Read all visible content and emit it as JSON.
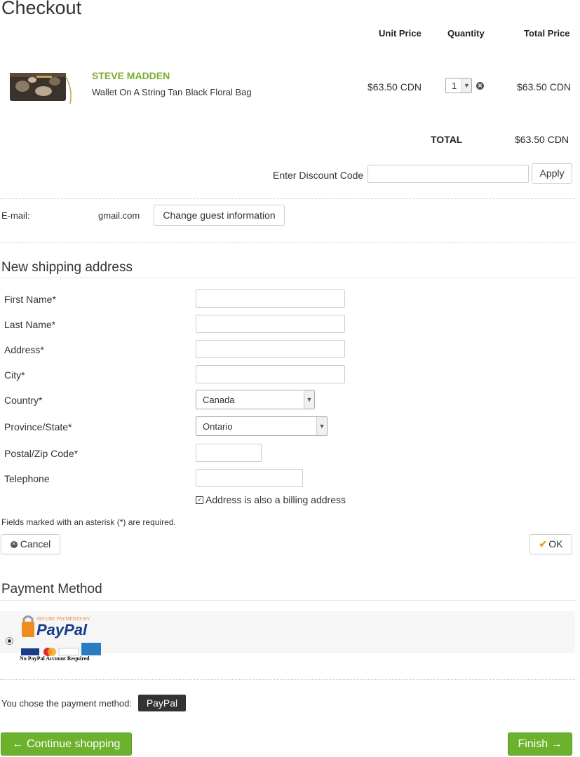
{
  "page": {
    "title": "Checkout"
  },
  "cart": {
    "headers": {
      "unit_price": "Unit Price",
      "quantity": "Quantity",
      "total_price": "Total Price"
    },
    "items": [
      {
        "brand": "STEVE MADDEN",
        "name": "Wallet On A String Tan Black Floral Bag",
        "unit_price": "$63.50 CDN",
        "quantity": "1",
        "total": "$63.50 CDN"
      }
    ],
    "total_label": "TOTAL",
    "total_value": "$63.50 CDN",
    "discount_label": "Enter Discount Code",
    "discount_value": "",
    "apply_label": "Apply"
  },
  "guest": {
    "email_label": "E-mail:",
    "email_value": "gmail.com",
    "change_label": "Change guest information"
  },
  "shipping": {
    "title": "New shipping address",
    "fields": {
      "first_name": "First Name*",
      "last_name": "Last Name*",
      "address": "Address*",
      "city": "City*",
      "country": "Country*",
      "province": "Province/State*",
      "postal": "Postal/Zip Code*",
      "telephone": "Telephone"
    },
    "country_value": "Canada",
    "province_value": "Ontario",
    "billing_checkbox_label": "Address is also a billing address",
    "billing_checked": true,
    "required_note": "Fields marked with an asterisk (*) are required.",
    "cancel_label": "Cancel",
    "ok_label": "OK"
  },
  "payment": {
    "title": "Payment Method",
    "logo_top": "SECURE PAYMENTS BY",
    "logo_brand": "PayPal",
    "logo_bottom": "No PayPal Account Required",
    "chosen_label": "You chose the payment method:",
    "chosen_value": "PayPal"
  },
  "actions": {
    "continue_label": "← Continue shopping",
    "finish_label": "Finish →"
  },
  "colors": {
    "accent_green": "#6cb22c",
    "brand_green": "#7aad2c"
  }
}
